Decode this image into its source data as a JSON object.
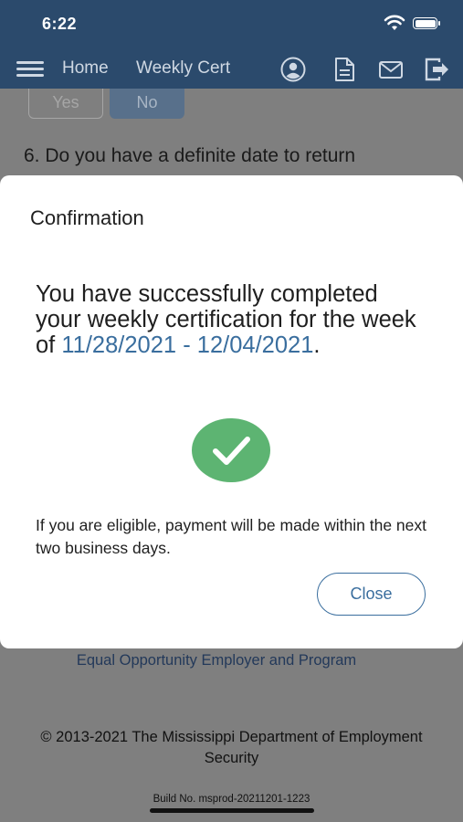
{
  "status_bar": {
    "time": "6:22"
  },
  "nav": {
    "home_label": "Home",
    "weekly_cert_label": "Weekly Cert",
    "icons": [
      "menu-icon",
      "profile-icon",
      "document-icon",
      "mail-icon",
      "logout-icon"
    ]
  },
  "background": {
    "yes_label": "Yes",
    "no_label": "No",
    "question": "6. Do you have a definite date to return",
    "equal_opportunity": "Equal Opportunity Employer and Program",
    "copyright_line1": "© 2013-2021 The Mississippi Department of Employment",
    "copyright_line2": "Security",
    "build": "Build No. msprod-20211201-1223"
  },
  "modal": {
    "title": "Confirmation",
    "message": "You have successfully completed your weekly certification for the week of",
    "date_range": "11/28/2021 - 12/04/2021",
    "period": ".",
    "info": "If you are eligible, payment will be made within the next two business days.",
    "close_label": "Close"
  },
  "colors": {
    "header": "#2b4a6c",
    "accent": "#3a6e9e",
    "success": "#5db472",
    "overlay": "#7f7f7f"
  }
}
